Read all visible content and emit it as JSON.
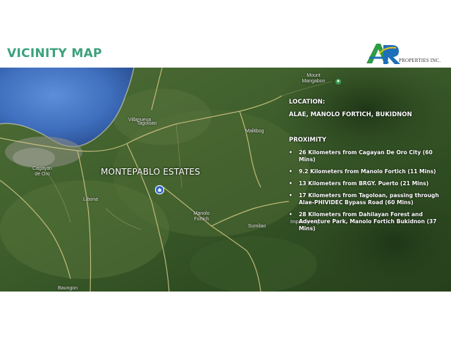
{
  "title": "VICINITY MAP",
  "logo": {
    "letters": "AR",
    "company": "PROPERTIES INC."
  },
  "map": {
    "estate_label": "MONTEPABLO ESTATES",
    "places": {
      "mount": "Mount\nMangabon",
      "villanueva": "Villanueva",
      "tagoloan": "Tagoloan",
      "malitbog": "Malitbog",
      "cagayan": "Cagayan\nde Oro",
      "libona": "Libona",
      "manolo": "Manolo\nFortich",
      "impasug": "Impasug-ong",
      "sumilao": "Sumilao",
      "baungon": "Baungon"
    }
  },
  "location": {
    "heading": "LOCATION:",
    "value": "ALAE, MANOLO FORTICH, BUKIDNON"
  },
  "proximity": {
    "heading": "PROXIMITY",
    "bullet": "•",
    "items": [
      "26 Kilometers from Cagayan De Oro City (60 Mins)",
      "9.2 Kilometers from Manolo Fortich (11 Mins)",
      "13 Kilometers from BRGY. Puerto (21 Mins)",
      "17 Kilometers from Tagoloan, passing through Alae-PHIVIDEC Bypass Road  (60 Mins)",
      "28 Kilometers from Dahilayan Forest and Adventure Park, Manolo Fortich Bukidnon (37 Mins)"
    ]
  }
}
